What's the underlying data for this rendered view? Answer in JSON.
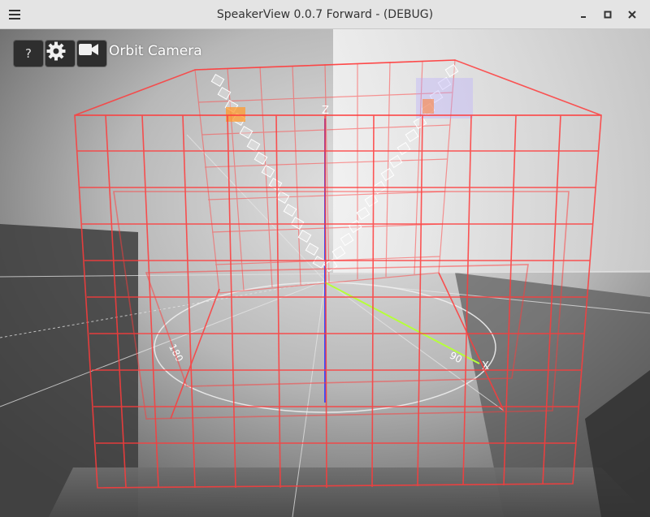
{
  "window": {
    "title": "SpeakerView 0.0.7 Forward - (DEBUG)",
    "menu_icon": "hamburger-menu-icon",
    "minimize_icon": "minimize-icon",
    "maximize_icon": "maximize-icon",
    "close_icon": "close-icon"
  },
  "toolbar": {
    "help_label": "?",
    "settings_icon": "gear-icon",
    "camera_icon": "video-camera-icon",
    "camera_mode_label": "Orbit Camera"
  },
  "scene": {
    "axis_z_label": "Z",
    "axis_x_label": "X",
    "ring_label_180": "180",
    "ring_label_90": "90",
    "colors": {
      "grid_cube": "#ff3b3b",
      "axis_z": "#3a4cff",
      "axis_x": "#b6ff3a",
      "floor_ring": "#e8e8e8",
      "speaker_array": "#f2f2f2"
    }
  }
}
